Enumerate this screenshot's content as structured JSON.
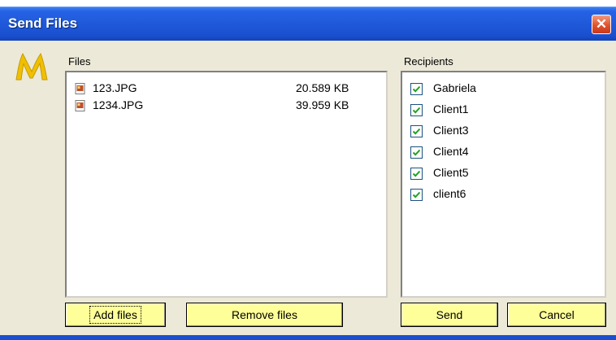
{
  "window": {
    "title": "Send Files",
    "close_glyph": "✕"
  },
  "colors": {
    "titlebar": "#1f59da",
    "dialog_bg": "#ece9d8",
    "button_bg": "#ffff99",
    "close_button": "#e0532e",
    "checkbox_mark": "#21a121",
    "logo": "#f0c000"
  },
  "logo": {
    "icon": "m-logo-icon"
  },
  "files": {
    "label": "Files",
    "items": [
      {
        "name": "123.JPG",
        "size": "20.589 KB",
        "icon": "jpg-file-icon"
      },
      {
        "name": "1234.JPG",
        "size": "39.959 KB",
        "icon": "jpg-file-icon"
      }
    ]
  },
  "recipients": {
    "label": "Recipients",
    "items": [
      {
        "name": "Gabriela",
        "checked": true
      },
      {
        "name": "Client1",
        "checked": true
      },
      {
        "name": "Client3",
        "checked": true
      },
      {
        "name": "Client4",
        "checked": true
      },
      {
        "name": "Client5",
        "checked": true
      },
      {
        "name": "client6",
        "checked": true
      }
    ]
  },
  "buttons": {
    "add_files": "Add files",
    "remove_files": "Remove files",
    "send": "Send",
    "cancel": "Cancel"
  }
}
